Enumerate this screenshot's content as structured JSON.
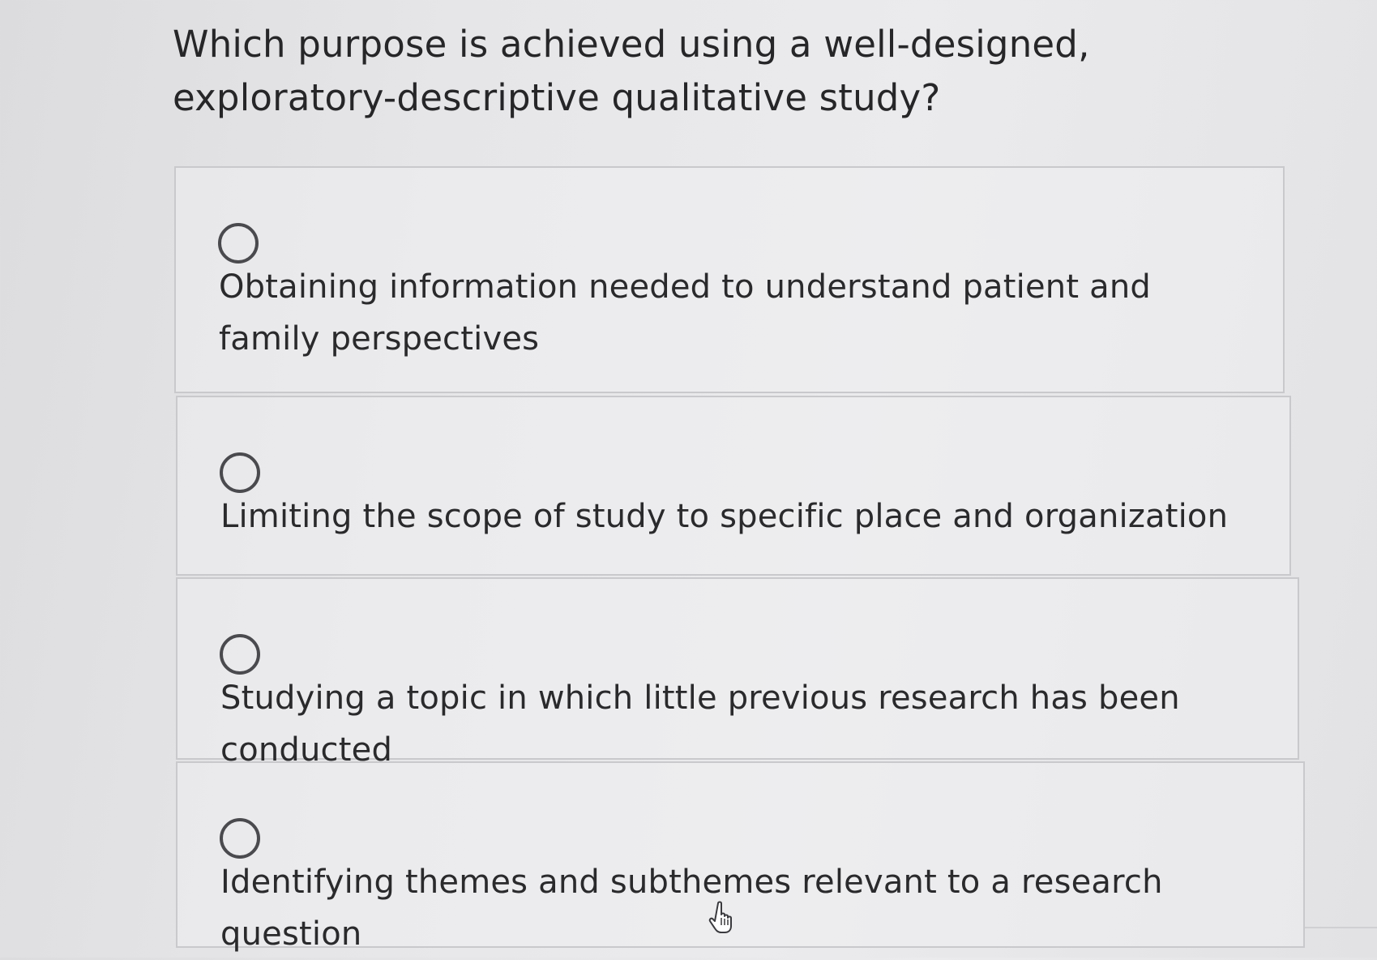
{
  "question": {
    "text": "Which purpose is achieved using a well-designed, exploratory-descriptive qualitative study?"
  },
  "options": [
    {
      "label": "Obtaining information needed to understand patient and family perspectives",
      "selected": false
    },
    {
      "label": "Limiting the scope of study to specific place and organization",
      "selected": false
    },
    {
      "label": "Studying a topic in which little previous research has been conducted",
      "selected": false
    },
    {
      "label": "Identifying themes and subthemes relevant to a research question",
      "selected": false
    }
  ],
  "cursor": {
    "icon": "hand-pointer-icon"
  }
}
